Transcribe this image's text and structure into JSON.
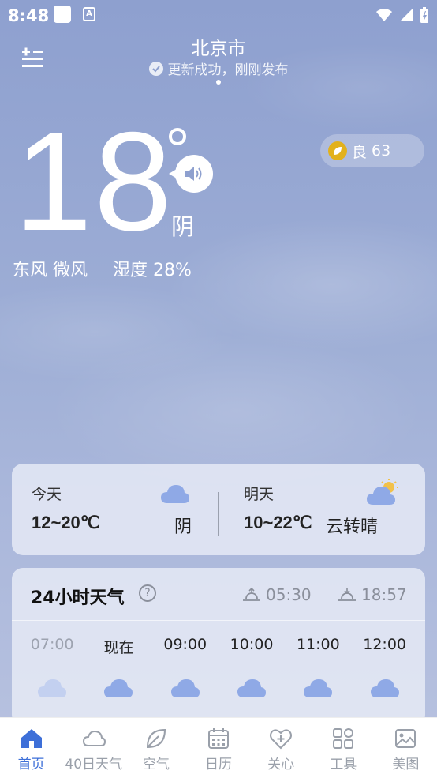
{
  "status_bar": {
    "time": "8:48"
  },
  "header": {
    "city": "北京市",
    "update_status": "更新成功，刚刚发布"
  },
  "current": {
    "temperature": "18",
    "condition": "阴",
    "wind": "东风 微风",
    "humidity": "湿度 28%",
    "aqi_level": "良",
    "aqi_value": "63",
    "aqi_color": "#e2b11c"
  },
  "forecast": {
    "today": {
      "label": "今天",
      "range": "12~20℃",
      "condition": "阴",
      "icon": "cloudy-icon"
    },
    "tomorrow": {
      "label": "明天",
      "range": "10~22℃",
      "condition": "云转晴",
      "icon": "partly-sunny-icon"
    }
  },
  "hourly": {
    "title": "24小时天气",
    "sunrise": "05:30",
    "sunset": "18:57",
    "hours": [
      {
        "time": "07:00",
        "past": true
      },
      {
        "time": "现在",
        "past": false
      },
      {
        "time": "09:00",
        "past": false
      },
      {
        "time": "10:00",
        "past": false
      },
      {
        "time": "11:00",
        "past": false
      },
      {
        "time": "12:00",
        "past": false
      }
    ]
  },
  "nav": {
    "items": [
      {
        "label": "首页",
        "icon": "home-icon",
        "active": true
      },
      {
        "label": "40日天气",
        "icon": "cloud-icon"
      },
      {
        "label": "空气",
        "icon": "leaf-icon"
      },
      {
        "label": "日历",
        "icon": "calendar-icon"
      },
      {
        "label": "关心",
        "icon": "heart-plus-icon"
      },
      {
        "label": "工具",
        "icon": "tools-grid-icon"
      },
      {
        "label": "美图",
        "icon": "image-icon"
      }
    ]
  },
  "colors": {
    "accent": "#3d6fd8",
    "cloud": "#8fa9e6",
    "sun": "#f2c14a"
  }
}
